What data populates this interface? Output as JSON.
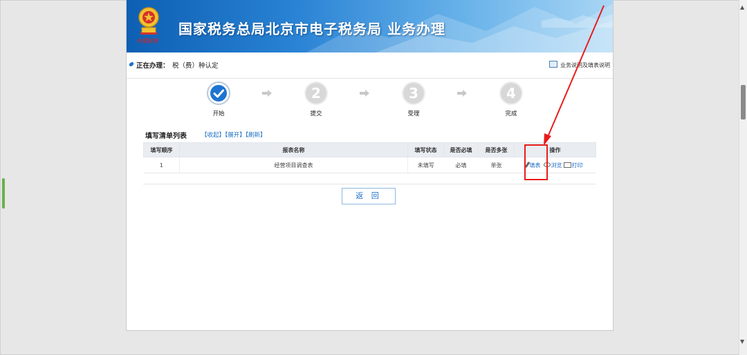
{
  "header": {
    "title": "国家税务总局北京市电子税务局  业务办理",
    "emblem_text": "中国税务"
  },
  "status": {
    "label": "正在办理：",
    "value": "税（费）种认定",
    "help_link": "业务说明及填表说明"
  },
  "steps": [
    {
      "number": "1",
      "label": "开始",
      "state": "done"
    },
    {
      "number": "2",
      "label": "提交",
      "state": "todo"
    },
    {
      "number": "3",
      "label": "受理",
      "state": "todo"
    },
    {
      "number": "4",
      "label": "完成",
      "state": "todo"
    }
  ],
  "list": {
    "title": "填写清单列表",
    "collapse": "【收起】",
    "expand": "【展开】",
    "refresh": "【刷新】"
  },
  "table": {
    "headers": [
      "填写顺序",
      "报表名称",
      "填写状态",
      "是否必填",
      "是否多张",
      "操作"
    ],
    "rows": [
      {
        "order": "1",
        "name": "经营项目调查表",
        "status": "未填写",
        "required": "必填",
        "multiple": "单张",
        "actions": {
          "fill": "填表",
          "browse": "浏览",
          "print": "打印"
        }
      }
    ]
  },
  "buttons": {
    "back": "返 回"
  },
  "colors": {
    "accent": "#1d6fc6",
    "step_done": "#1d74d0",
    "step_todo": "#d8d8d8",
    "annotation": "#e81c1c"
  }
}
